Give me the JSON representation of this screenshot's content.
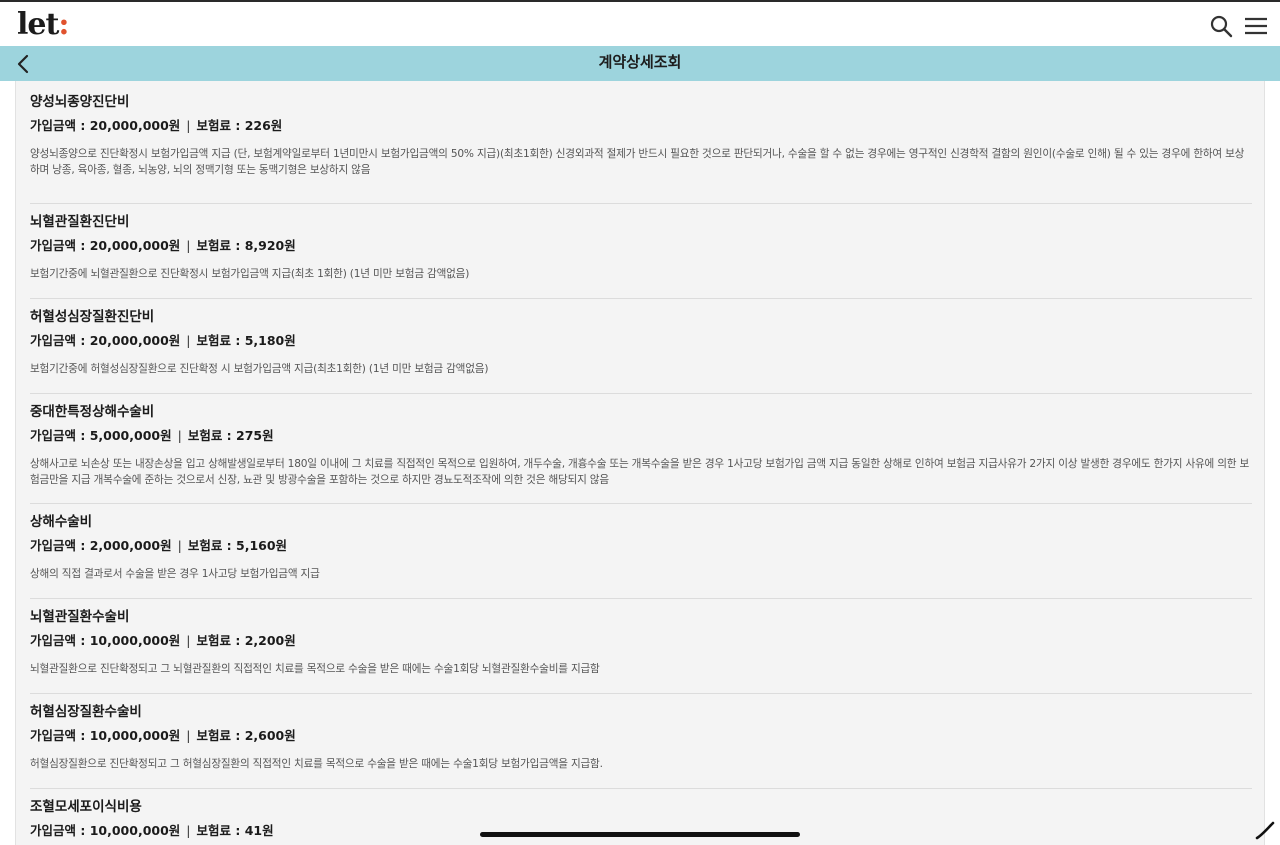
{
  "header": {
    "logo_main": "let",
    "logo_colon": ":",
    "title": "계약상세조회"
  },
  "icons": {
    "search": "search-icon",
    "menu": "menu-icon",
    "back": "back-icon",
    "pencil": "pencil-icon"
  },
  "colors": {
    "title_bar": "#9dd4dd",
    "logo_accent": "#e0522e",
    "content_bg": "#f4f4f4"
  },
  "labels": {
    "amount": "가입금액 : ",
    "premium": "보험료 : ",
    "separator": "|"
  },
  "items": [
    {
      "name": "양성뇌종양진단비",
      "amount": "20,000,000원",
      "premium": "226원",
      "description": "양성뇌종양으로 진단확정시 보험가입금액 지급 (단, 보험계약일로부터 1년미만시 보험가입금액의 50% 지급)(최초1회한) 신경외과적 절제가 반드시 필요한 것으로 판단되거나, 수술을 할 수 없는 경우에는 영구적인 신경학적 결함의 원인이(수술로 인해) 될 수 있는 경우에 한하여 보상하며 낭종, 육아종, 혈종, 뇌농양, 뇌의 정맥기형 또는 동맥기형은 보상하지 않음"
    },
    {
      "name": "뇌혈관질환진단비",
      "amount": "20,000,000원",
      "premium": "8,920원",
      "description": "보험기간중에 뇌혈관질환으로 진단확정시 보험가입금액 지급(최초 1회한) (1년 미만 보험금 감액없음)"
    },
    {
      "name": "허혈성심장질환진단비",
      "amount": "20,000,000원",
      "premium": "5,180원",
      "description": "보험기간중에 허혈성심장질환으로 진단확정 시 보험가입금액 지급(최초1회한) (1년 미만 보험금 감액없음)"
    },
    {
      "name": "중대한특정상해수술비",
      "amount": "5,000,000원",
      "premium": "275원",
      "description": "상해사고로 뇌손상 또는 내장손상을 입고 상해발생일로부터 180일 이내에 그 치료를 직접적인 목적으로 입원하여, 개두수술, 개흉수술 또는 개복수술을 받은 경우 1사고당 보험가입 금액 지급 동일한 상해로 인하여 보험금 지급사유가 2가지 이상 발생한 경우에도 한가지 사유에 의한 보험금만을 지급 개복수술에 준하는 것으로서 신장, 뇨관 및 방광수술을 포함하는 것으로 하지만 경뇨도적조작에 의한 것은 해당되지 않음"
    },
    {
      "name": "상해수술비",
      "amount": "2,000,000원",
      "premium": "5,160원",
      "description": "상해의 직접 결과로서 수술을 받은 경우 1사고당 보험가입금액 지급"
    },
    {
      "name": "뇌혈관질환수술비",
      "amount": "10,000,000원",
      "premium": "2,200원",
      "description": "뇌혈관질환으로 진단확정되고 그 뇌혈관질환의 직접적인 치료를 목적으로 수술을 받은 때에는 수술1회당 뇌혈관질환수술비를 지급함"
    },
    {
      "name": "허혈심장질환수술비",
      "amount": "10,000,000원",
      "premium": "2,600원",
      "description": "허혈심장질환으로 진단확정되고 그 허혈심장질환의 직접적인 치료를 목적으로 수술을 받은 때에는 수술1회당 보험가입금액을 지급함."
    },
    {
      "name": "조혈모세포이식비용",
      "amount": "10,000,000원",
      "premium": "41원",
      "description": ""
    }
  ]
}
